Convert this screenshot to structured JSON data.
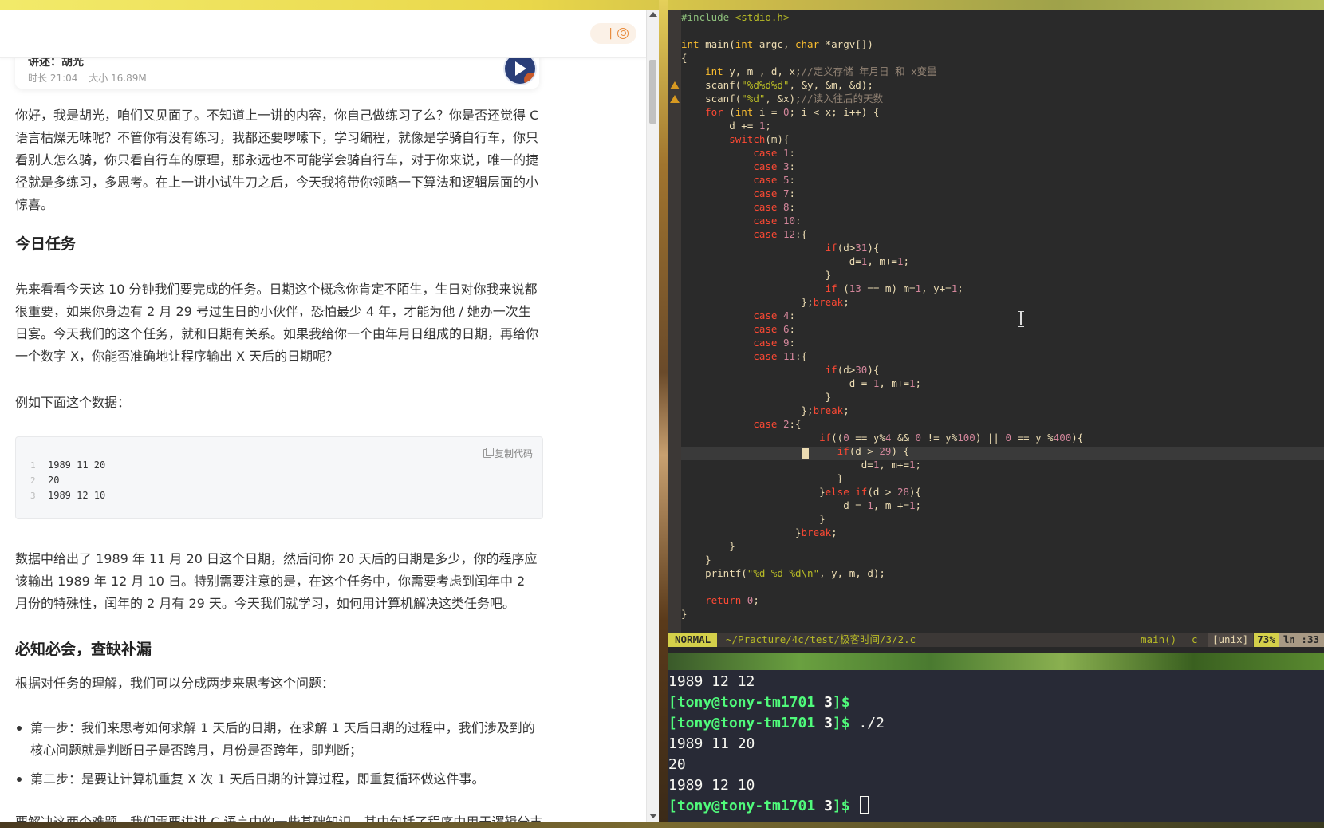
{
  "article": {
    "audio": {
      "title": "讲述：胡光",
      "duration": "时长 21:04",
      "size": "大小 16.89M"
    },
    "intro": "你好，我是胡光，咱们又见面了。不知道上一讲的内容，你自己做练习了么？你是否还觉得 C 语言枯燥无味呢？不管你有没有练习，我都还要啰嗦下，学习编程，就像是学骑自行车，你只看别人怎么骑，你只看自行车的原理，那永远也不可能学会骑自行车，对于你来说，唯一的捷径就是多练习，多思考。在上一讲小试牛刀之后，今天我将带你领略一下算法和逻辑层面的小惊喜。",
    "h_task": "今日任务",
    "task_para": "先来看看今天这 10 分钟我们要完成的任务。日期这个概念你肯定不陌生，生日对你我来说都很重要，如果你身边有 2 月 29 号过生日的小伙伴，恐怕最少 4 年，才能为他 / 她办一次生日宴。今天我们的这个任务，就和日期有关系。如果我给你一个由年月日组成的日期，再给你一个数字 X，你能否准确地让程序输出 X 天后的日期呢？",
    "example_intro": "例如下面这个数据：",
    "copy_label": "复制代码",
    "code_lines": [
      {
        "n": "1",
        "text": "1989 11 20"
      },
      {
        "n": "2",
        "text": "20"
      },
      {
        "n": "3",
        "text": "1989 12 10"
      }
    ],
    "data_para": "数据中给出了 1989 年 11 月 20 日这个日期，然后问你 20 天后的日期是多少，你的程序应该输出 1989 年 12 月 10 日。特别需要注意的是，在这个任务中，你需要考虑到闰年中 2 月份的特殊性，闰年的 2 月有 29 天。今天我们就学习，如何用计算机解决这类任务吧。",
    "h_basics": "必知必会，查缺补漏",
    "basics_para": "根据对任务的理解，我们可以分成两步来思考这个问题：",
    "bullets": [
      "第一步：我们来思考如何求解 1 天后的日期，在求解 1 天后日期的过程中，我们涉及到的核心问题就是判断日子是否跨月，月份是否跨年，即判断；",
      "第二步：是要让计算机重复 X 次 1 天后日期的计算过程，即重复循环做这件事。"
    ],
    "tail_para": "要解决这两个难题，我们需要讲讲 C 语言中的一些基础知识，其中包括了程序中用于逻辑分支"
  },
  "vim": {
    "mode": "NORMAL",
    "path": "~/Practure/4c/test/极客时间/3/2.c",
    "func": "main()",
    "filetype": "c",
    "fileformat": "[unix]",
    "percent": "73%",
    "position": "ln :33"
  },
  "terminal": {
    "lines": [
      {
        "kind": "out",
        "text": "1989 12 12"
      },
      {
        "kind": "prompt",
        "user": "[tony@tony-tm1701 ",
        "dir": "3",
        "end": "]$",
        "cmd": ""
      },
      {
        "kind": "prompt",
        "user": "[tony@tony-tm1701 ",
        "dir": "3",
        "end": "]$",
        "cmd": " ./2"
      },
      {
        "kind": "out",
        "text": "1989 11 20"
      },
      {
        "kind": "out",
        "text": "20"
      },
      {
        "kind": "out",
        "text": "1989 12 10"
      },
      {
        "kind": "prompt",
        "user": "[tony@tony-tm1701 ",
        "dir": "3",
        "end": "]$",
        "cmd": " "
      }
    ]
  }
}
